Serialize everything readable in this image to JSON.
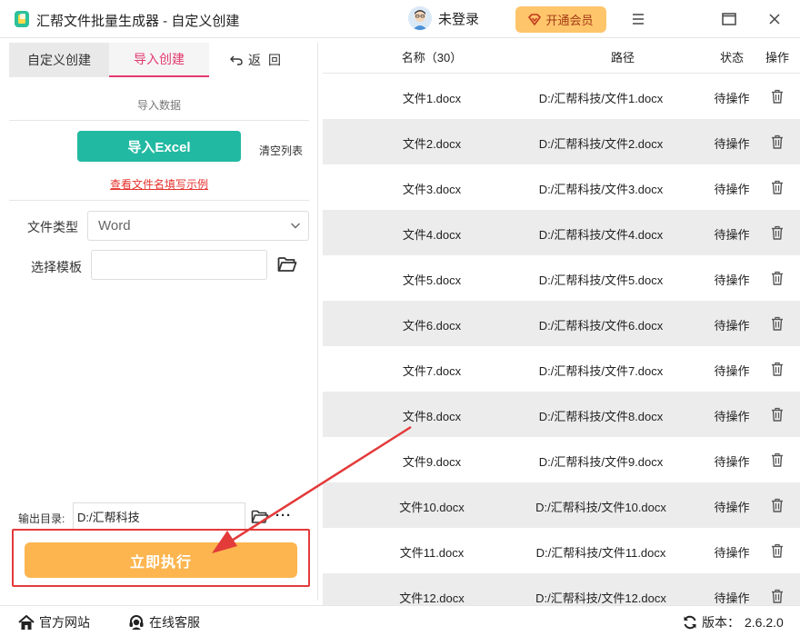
{
  "app": {
    "title": "汇帮文件批量生成器 - 自定义创建",
    "login_text": "未登录",
    "vip_label": "开通会员"
  },
  "tabs": [
    {
      "label": "自定义创建"
    },
    {
      "label": "导入创建"
    },
    {
      "label": "返回"
    }
  ],
  "import": {
    "section_label": "导入数据",
    "excel_button": "导入Excel",
    "clear_link": "清空列表",
    "example_link": "查看文件名填写示例"
  },
  "form": {
    "file_type_label": "文件类型",
    "file_type_value": "Word",
    "template_label": "选择模板",
    "template_value": "",
    "output_label": "输出目录:",
    "output_value": "D:/汇帮科技",
    "more_icon": "···",
    "run_button": "立即执行"
  },
  "table": {
    "headers": {
      "name": "名称（30）",
      "path": "路径",
      "status": "状态",
      "action": "操作"
    },
    "rows": [
      {
        "name": "文件1.docx",
        "path": "D:/汇帮科技/文件1.docx",
        "status": "待操作"
      },
      {
        "name": "文件2.docx",
        "path": "D:/汇帮科技/文件2.docx",
        "status": "待操作"
      },
      {
        "name": "文件3.docx",
        "path": "D:/汇帮科技/文件3.docx",
        "status": "待操作"
      },
      {
        "name": "文件4.docx",
        "path": "D:/汇帮科技/文件4.docx",
        "status": "待操作"
      },
      {
        "name": "文件5.docx",
        "path": "D:/汇帮科技/文件5.docx",
        "status": "待操作"
      },
      {
        "name": "文件6.docx",
        "path": "D:/汇帮科技/文件6.docx",
        "status": "待操作"
      },
      {
        "name": "文件7.docx",
        "path": "D:/汇帮科技/文件7.docx",
        "status": "待操作"
      },
      {
        "name": "文件8.docx",
        "path": "D:/汇帮科技/文件8.docx",
        "status": "待操作"
      },
      {
        "name": "文件9.docx",
        "path": "D:/汇帮科技/文件9.docx",
        "status": "待操作"
      },
      {
        "name": "文件10.docx",
        "path": "D:/汇帮科技/文件10.docx",
        "status": "待操作"
      },
      {
        "name": "文件11.docx",
        "path": "D:/汇帮科技/文件11.docx",
        "status": "待操作"
      },
      {
        "name": "文件12.docx",
        "path": "D:/汇帮科技/文件12.docx",
        "status": "待操作"
      }
    ]
  },
  "footer": {
    "website_label": "官方网站",
    "service_label": "在线客服",
    "version_label": "版本：",
    "version_value": "2.6.2.0"
  },
  "colors": {
    "accent_tab": "#e4396f",
    "excel_button": "#22b9a2",
    "run_button": "#fcb54f",
    "highlight_border": "#e33a3a",
    "vip_button": "#fec56b"
  },
  "icons": {
    "logo": "app-logo-icon",
    "avatar": "user-avatar-icon",
    "vip": "diamond-icon",
    "menu": "menu-icon",
    "maximize": "maximize-icon",
    "close": "close-icon",
    "back": "back-arrow-icon",
    "chevron": "chevron-down-icon",
    "folder": "folder-icon",
    "more": "more-dots-icon",
    "trash": "trash-icon",
    "home": "home-icon",
    "headset": "headset-icon",
    "refresh": "refresh-icon"
  }
}
